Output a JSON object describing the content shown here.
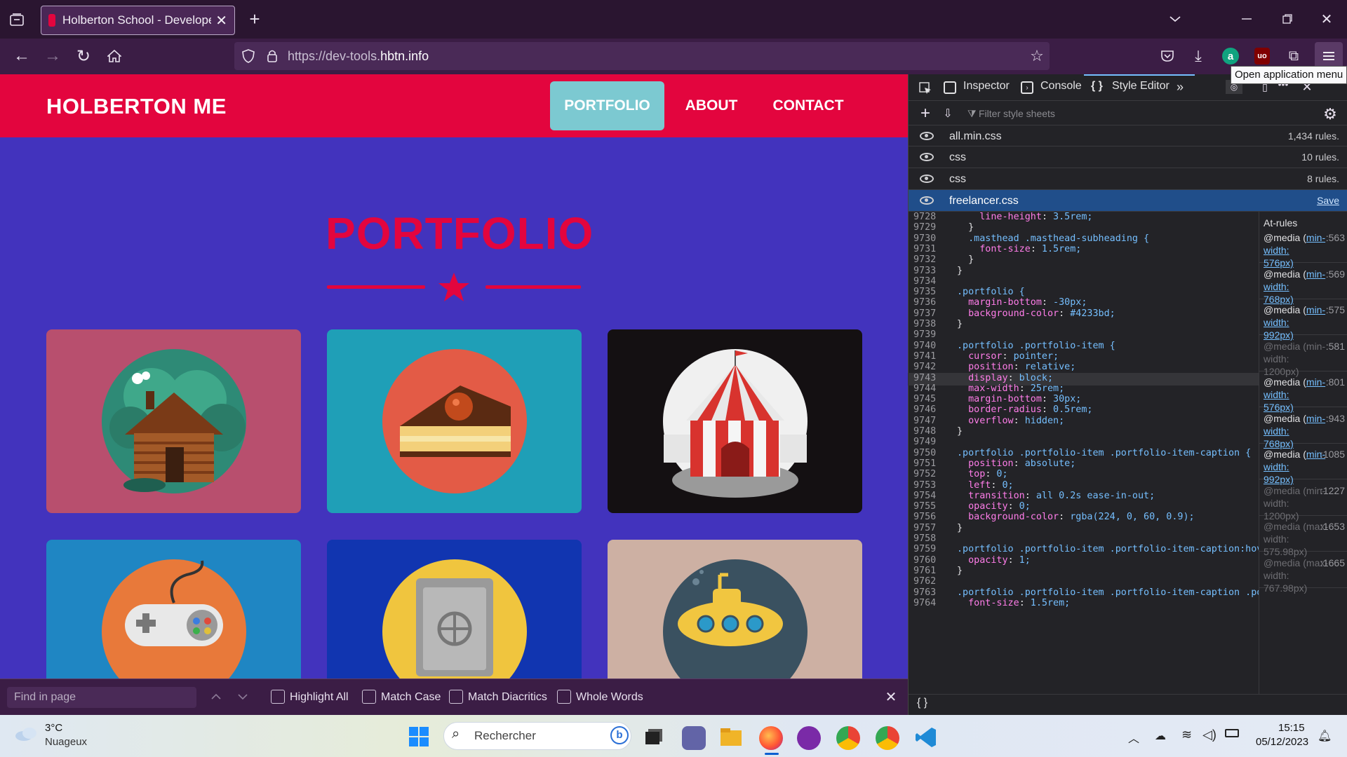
{
  "browser": {
    "tab_title": "Holberton School - Developer t",
    "url_prefix": "https://dev-tools.",
    "url_domain": "hbtn.info",
    "tooltip": "Open application menu"
  },
  "site": {
    "brand": "HOLBERTON ME",
    "nav": [
      "PORTFOLIO",
      "ABOUT",
      "CONTACT"
    ],
    "section_title": "PORTFOLIO",
    "colors": {
      "header": "#e3053e",
      "background": "#4233bd",
      "accent": "#7cc9d1"
    },
    "items": [
      {
        "icon": "cabin-icon",
        "bg": "#b84f6e"
      },
      {
        "icon": "cake-icon",
        "bg": "#1f9fb7"
      },
      {
        "icon": "circus-tent-icon",
        "bg": "#141012"
      },
      {
        "icon": "game-controller-icon",
        "bg": "#1f86c3"
      },
      {
        "icon": "safe-icon",
        "bg": "#1135b0"
      },
      {
        "icon": "submarine-icon",
        "bg": "#cdb0a3"
      }
    ]
  },
  "findbar": {
    "placeholder": "Find in page",
    "options": [
      "Highlight All",
      "Match Case",
      "Match Diacritics",
      "Whole Words"
    ]
  },
  "devtools": {
    "tabs": [
      "Inspector",
      "Console",
      "Style Editor"
    ],
    "filter_placeholder": "Filter style sheets",
    "sheets": [
      {
        "name": "all.min.css",
        "rules": "1,434 rules."
      },
      {
        "name": "css",
        "rules": "10 rules."
      },
      {
        "name": "css",
        "rules": "8 rules."
      },
      {
        "name": "freelancer.css",
        "rules": "Save"
      }
    ],
    "code": [
      {
        "n": "9728",
        "t": "    line-height: 3.5rem;"
      },
      {
        "n": "9729",
        "t": "  }"
      },
      {
        "n": "9730",
        "t": "  .masthead .masthead-subheading {"
      },
      {
        "n": "9731",
        "t": "    font-size: 1.5rem;"
      },
      {
        "n": "9732",
        "t": "  }"
      },
      {
        "n": "9733",
        "t": "}"
      },
      {
        "n": "9734",
        "t": ""
      },
      {
        "n": "9735",
        "t": ".portfolio {"
      },
      {
        "n": "9736",
        "t": "  margin-bottom: -30px;"
      },
      {
        "n": "9737",
        "t": "  background-color: #4233bd;"
      },
      {
        "n": "9738",
        "t": "}"
      },
      {
        "n": "9739",
        "t": ""
      },
      {
        "n": "9740",
        "t": ".portfolio .portfolio-item {"
      },
      {
        "n": "9741",
        "t": "  cursor: pointer;"
      },
      {
        "n": "9742",
        "t": "  position: relative;"
      },
      {
        "n": "9743",
        "t": "  display: block;"
      },
      {
        "n": "9744",
        "t": "  max-width: 25rem;"
      },
      {
        "n": "9745",
        "t": "  margin-bottom: 30px;"
      },
      {
        "n": "9746",
        "t": "  border-radius: 0.5rem;"
      },
      {
        "n": "9747",
        "t": "  overflow: hidden;"
      },
      {
        "n": "9748",
        "t": "}"
      },
      {
        "n": "9749",
        "t": ""
      },
      {
        "n": "9750",
        "t": ".portfolio .portfolio-item .portfolio-item-caption {"
      },
      {
        "n": "9751",
        "t": "  position: absolute;"
      },
      {
        "n": "9752",
        "t": "  top: 0;"
      },
      {
        "n": "9753",
        "t": "  left: 0;"
      },
      {
        "n": "9754",
        "t": "  transition: all 0.2s ease-in-out;"
      },
      {
        "n": "9755",
        "t": "  opacity: 0;"
      },
      {
        "n": "9756",
        "t": "  background-color: rgba(224, 0, 60, 0.9);"
      },
      {
        "n": "9757",
        "t": "}"
      },
      {
        "n": "9758",
        "t": ""
      },
      {
        "n": "9759",
        "t": ".portfolio .portfolio-item .portfolio-item-caption:hov"
      },
      {
        "n": "9760",
        "t": "  opacity: 1;"
      },
      {
        "n": "9761",
        "t": "}"
      },
      {
        "n": "9762",
        "t": ""
      },
      {
        "n": "9763",
        "t": ".portfolio .portfolio-item .portfolio-item-caption .po"
      },
      {
        "n": "9764",
        "t": "  font-size: 1.5rem;"
      }
    ],
    "at_rules_title": "At-rules",
    "at_rules": [
      {
        "a": "@media (",
        "b": "min-width:",
        "c": "576px)",
        "line": ":563",
        "dim": false
      },
      {
        "a": "@media (",
        "b": "min-width:",
        "c": "768px)",
        "line": ":569",
        "dim": false
      },
      {
        "a": "@media (",
        "b": "min-width:",
        "c": "992px)",
        "line": ":575",
        "dim": false
      },
      {
        "a": "@media (",
        "b": "min-width:",
        "c": "1200px)",
        "line": ":581",
        "dim": true
      },
      {
        "a": "@media (",
        "b": "min-width:",
        "c": "576px)",
        "line": ":801",
        "dim": false
      },
      {
        "a": "@media (",
        "b": "min-width:",
        "c": "768px)",
        "line": ":943",
        "dim": false
      },
      {
        "a": "@media (",
        "b": "min-width:",
        "c": "992px)",
        "line": ":1085",
        "dim": false
      },
      {
        "a": "@media (",
        "b": "min-width:",
        "c": "1200px)",
        "line": ":1227",
        "dim": true
      },
      {
        "a": "@media (",
        "b": "max-width:",
        "c": "575.98px)",
        "line": ":1653",
        "dim": true
      },
      {
        "a": "@media (",
        "b": "max-width:",
        "c": "767.98px)",
        "line": ":1665",
        "dim": true
      }
    ]
  },
  "taskbar": {
    "temperature": "3°C",
    "weather": "Nuageux",
    "search": "Rechercher",
    "time": "15:15",
    "date": "05/12/2023"
  }
}
